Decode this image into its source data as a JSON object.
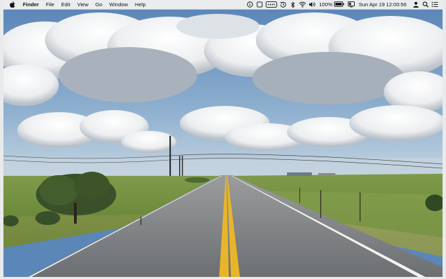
{
  "menubar": {
    "app_name": "Finder",
    "menus": [
      "File",
      "Edit",
      "View",
      "Go",
      "Window",
      "Help"
    ],
    "battery_percent": "100%",
    "clock": "Sun Apr 19  12:00:56"
  },
  "status_icons": [
    "info-icon",
    "stop-icon",
    "password-icon",
    "time-machine-icon",
    "bluetooth-icon",
    "wifi-icon",
    "volume-icon",
    "battery-icon",
    "display-icon",
    "user-icon",
    "search-icon",
    "menu-list-icon"
  ],
  "desktop": {
    "wallpaper": "country-road-landscape",
    "colors": {
      "sky_top": "#5b86b8",
      "sky_bottom": "#b8cfe0",
      "grass": "#6f8e3c",
      "road": "#76797c",
      "center_line": "#e8b52a"
    }
  }
}
